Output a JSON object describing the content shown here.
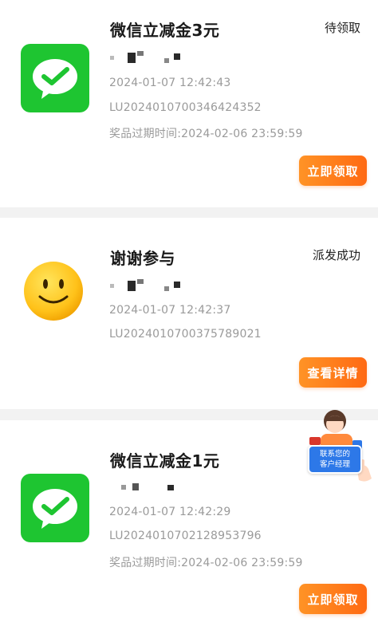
{
  "rewards": [
    {
      "title": "微信立减金3元",
      "status": "待领取",
      "icon": "wechat-icon",
      "time": "2024-01-07 12:42:43",
      "order_id": "LU2024010700346424352",
      "expiry": "奖品过期时间:2024-02-06 23:59:59",
      "button": "立即领取"
    },
    {
      "title": "谢谢参与",
      "status": "派发成功",
      "icon": "smiley-icon",
      "time": "2024-01-07 12:42:37",
      "order_id": "LU2024010700375789021",
      "button": "查看详情"
    },
    {
      "title": "微信立减金1元",
      "status": "",
      "icon": "wechat-icon",
      "time": "2024-01-07 12:42:29",
      "order_id": "LU2024010702128953796",
      "expiry": "奖品过期时间:2024-02-06 23:59:59",
      "button": "立即领取"
    }
  ],
  "service": {
    "line1": "联系您的",
    "line2": "客户经理"
  },
  "colors": {
    "wechat_green": "#1ec531",
    "button_orange": "#ff7a1a",
    "meta_gray": "#9a9a9a",
    "service_blue": "#2d78e8"
  }
}
